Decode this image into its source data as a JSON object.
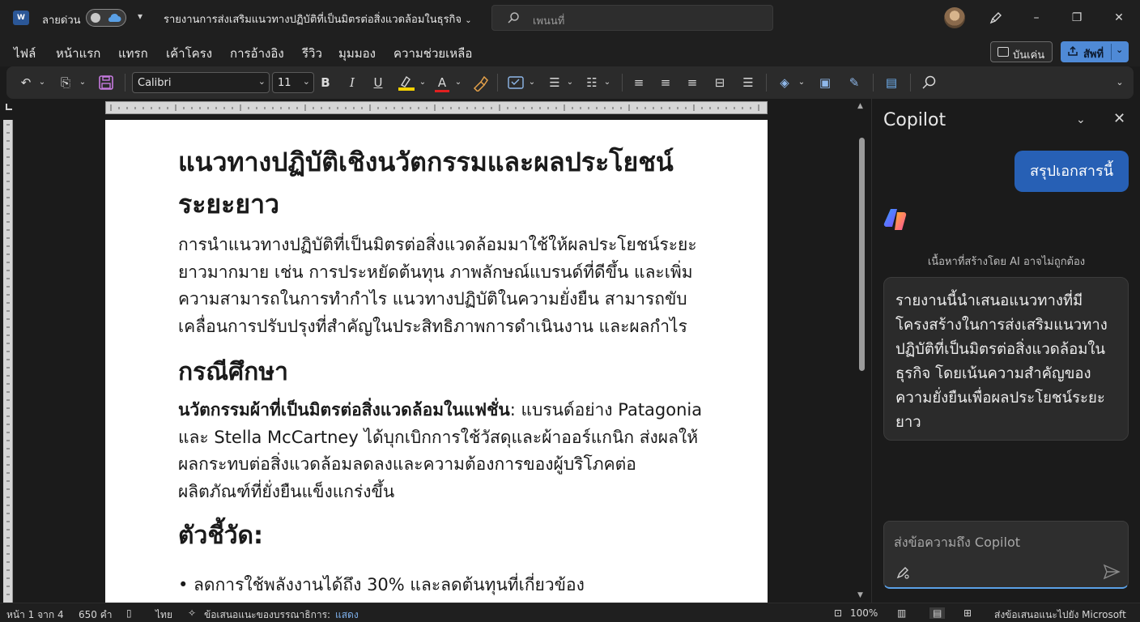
{
  "titlebar": {
    "autosave_label": "ลายด่วน",
    "document_title": "รายงานการส่งเสริมแนวทางปฏิบัติที่เป็นมิตรต่อสิ่งแวดล้อมในธุรกิจ",
    "search_placeholder": "เพนนที่"
  },
  "tabs": [
    {
      "label": "ไฟล์"
    },
    {
      "label": "หน้าแรก"
    },
    {
      "label": "แทรก"
    },
    {
      "label": "เค้าโครง"
    },
    {
      "label": "การอ้างอิง"
    },
    {
      "label": "รีวิว"
    },
    {
      "label": "มุมมอง"
    },
    {
      "label": "ความช่วยเหลือ"
    }
  ],
  "actions": {
    "comments_label": "บันเค่น",
    "share_label": "สัพที่"
  },
  "ribbon": {
    "font_name": "Calibri",
    "font_size": "11",
    "underline_color": "#f5d200",
    "font_color": "#e02020"
  },
  "document": {
    "heading1": "แนวทางปฏิบัติเชิงนวัตกรรมและผลประโยชน์ระยะยาว",
    "para1": "การนำแนวทางปฏิบัติที่เป็นมิตรต่อสิ่งแวดล้อมมาใช้ให้ผลประโยชน์ระยะยาวมากมาย เช่น การประหยัดต้นทุน ภาพลักษณ์แบรนด์ที่ดีขึ้น และเพิ่มความสามารถในการทำกำไร แนวทางปฏิบัติในความยั่งยืน สามารถขับเคลื่อนการปรับปรุงที่สำคัญในประสิทธิภาพการดำเนินงาน และผลกำไร",
    "heading2": "กรณีศึกษา",
    "para2_bold": "นวัตกรรมผ้าที่เป็นมิตรต่อสิ่งแวดล้อมในแฟชั่น",
    "para2_rest": ": แบรนด์อย่าง Patagonia และ Stella McCartney ได้บุกเบิกการใช้วัสดุและผ้าออร์แกนิก ส่งผลให้ผลกระทบต่อสิ่งแวดล้อมลดลงและความต้องการของผู้บริโภคต่อผลิตภัณฑ์ที่ยั่งยืนแข็งแกร่งขึ้น",
    "heading3": "ตัวชี้วัด:",
    "cut_text": "• ลดการใช้พลังงานได้ถึง 30% และลดต้นทุนที่เกี่ยวข้อง"
  },
  "copilot": {
    "title": "Copilot",
    "user_message": "สรุปเอกสารนี้",
    "ai_disclaimer": "เนื้อหาที่สร้างโดย AI อาจไม่ถูกต้อง",
    "ai_response": "รายงานนี้นำเสนอแนวทางที่มีโครงสร้างในการส่งเสริมแนวทางปฏิบัติที่เป็นมิตรต่อสิ่งแวดล้อมในธุรกิจ โดยเน้นความสำคัญของความยั่งยืนเพื่อผลประโยชน์ระยะยาว",
    "input_placeholder": "ส่งข้อความถึง Copilot"
  },
  "statusbar": {
    "page_info": "หน้า 1 จาก 4",
    "word_count": "650 คำ",
    "language": "ไทย",
    "editor_label": "ข้อเสนอแนะของบรรณาธิการ:",
    "editor_link": "แสดง",
    "zoom": "100%",
    "feedback": "ส่งข้อเสนอแนะไปยัง Microsoft"
  }
}
